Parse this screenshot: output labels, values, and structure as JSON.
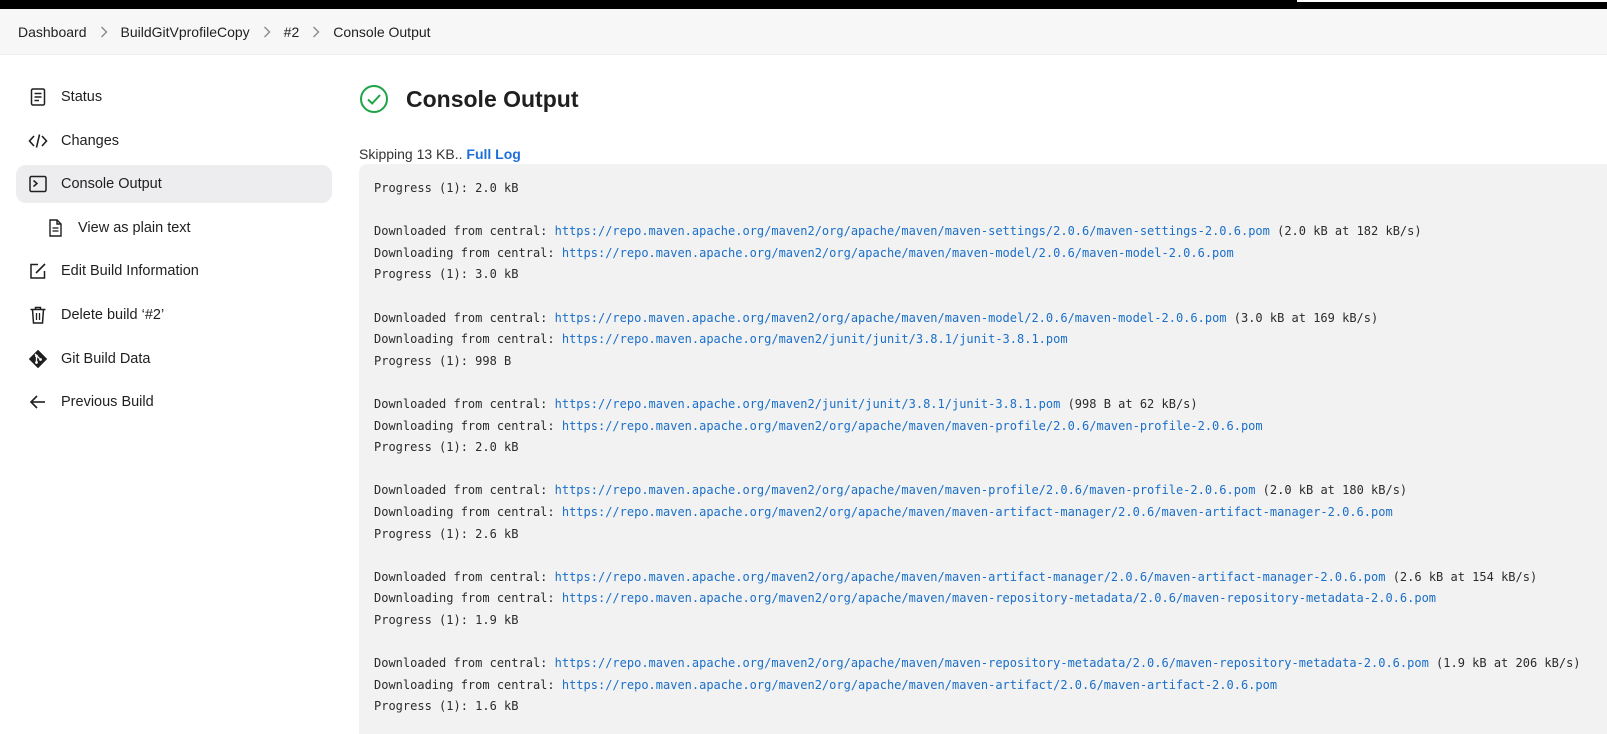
{
  "breadcrumb": [
    "Dashboard",
    "BuildGitVprofileCopy",
    "#2",
    "Console Output"
  ],
  "sidebar": {
    "items": [
      {
        "label": "Status",
        "icon": "status-icon"
      },
      {
        "label": "Changes",
        "icon": "code-icon"
      },
      {
        "label": "Console Output",
        "icon": "terminal-icon",
        "active": true
      },
      {
        "label": "View as plain text",
        "icon": "document-icon",
        "sub": true
      },
      {
        "label": "Edit Build Information",
        "icon": "edit-icon"
      },
      {
        "label": "Delete build ‘#2’",
        "icon": "trash-icon"
      },
      {
        "label": "Git Build Data",
        "icon": "git-icon"
      },
      {
        "label": "Previous Build",
        "icon": "arrow-left-icon"
      }
    ]
  },
  "main": {
    "title": "Console Output",
    "status_color": "#1ea446",
    "skip_text": "Skipping 13 KB.. ",
    "full_log_label": "Full Log"
  },
  "console": {
    "lines": [
      {
        "text": "Progress (1): 2.0 kB"
      },
      {
        "text": ""
      },
      {
        "prefix": "Downloaded from central: ",
        "url": "https://repo.maven.apache.org/maven2/org/apache/maven/maven-settings/2.0.6/maven-settings-2.0.6.pom",
        "suffix": " (2.0 kB at 182 kB/s)"
      },
      {
        "prefix": "Downloading from central: ",
        "url": "https://repo.maven.apache.org/maven2/org/apache/maven/maven-model/2.0.6/maven-model-2.0.6.pom",
        "suffix": ""
      },
      {
        "text": "Progress (1): 3.0 kB"
      },
      {
        "text": ""
      },
      {
        "prefix": "Downloaded from central: ",
        "url": "https://repo.maven.apache.org/maven2/org/apache/maven/maven-model/2.0.6/maven-model-2.0.6.pom",
        "suffix": " (3.0 kB at 169 kB/s)"
      },
      {
        "prefix": "Downloading from central: ",
        "url": "https://repo.maven.apache.org/maven2/junit/junit/3.8.1/junit-3.8.1.pom",
        "suffix": ""
      },
      {
        "text": "Progress (1): 998 B"
      },
      {
        "text": ""
      },
      {
        "prefix": "Downloaded from central: ",
        "url": "https://repo.maven.apache.org/maven2/junit/junit/3.8.1/junit-3.8.1.pom",
        "suffix": " (998 B at 62 kB/s)"
      },
      {
        "prefix": "Downloading from central: ",
        "url": "https://repo.maven.apache.org/maven2/org/apache/maven/maven-profile/2.0.6/maven-profile-2.0.6.pom",
        "suffix": ""
      },
      {
        "text": "Progress (1): 2.0 kB"
      },
      {
        "text": ""
      },
      {
        "prefix": "Downloaded from central: ",
        "url": "https://repo.maven.apache.org/maven2/org/apache/maven/maven-profile/2.0.6/maven-profile-2.0.6.pom",
        "suffix": " (2.0 kB at 180 kB/s)"
      },
      {
        "prefix": "Downloading from central: ",
        "url": "https://repo.maven.apache.org/maven2/org/apache/maven/maven-artifact-manager/2.0.6/maven-artifact-manager-2.0.6.pom",
        "suffix": ""
      },
      {
        "text": "Progress (1): 2.6 kB"
      },
      {
        "text": ""
      },
      {
        "prefix": "Downloaded from central: ",
        "url": "https://repo.maven.apache.org/maven2/org/apache/maven/maven-artifact-manager/2.0.6/maven-artifact-manager-2.0.6.pom",
        "suffix": " (2.6 kB at 154 kB/s)"
      },
      {
        "prefix": "Downloading from central: ",
        "url": "https://repo.maven.apache.org/maven2/org/apache/maven/maven-repository-metadata/2.0.6/maven-repository-metadata-2.0.6.pom",
        "suffix": ""
      },
      {
        "text": "Progress (1): 1.9 kB"
      },
      {
        "text": ""
      },
      {
        "prefix": "Downloaded from central: ",
        "url": "https://repo.maven.apache.org/maven2/org/apache/maven/maven-repository-metadata/2.0.6/maven-repository-metadata-2.0.6.pom",
        "suffix": " (1.9 kB at 206 kB/s)"
      },
      {
        "prefix": "Downloading from central: ",
        "url": "https://repo.maven.apache.org/maven2/org/apache/maven/maven-artifact/2.0.6/maven-artifact-2.0.6.pom",
        "suffix": ""
      },
      {
        "text": "Progress (1): 1.6 kB"
      }
    ]
  }
}
